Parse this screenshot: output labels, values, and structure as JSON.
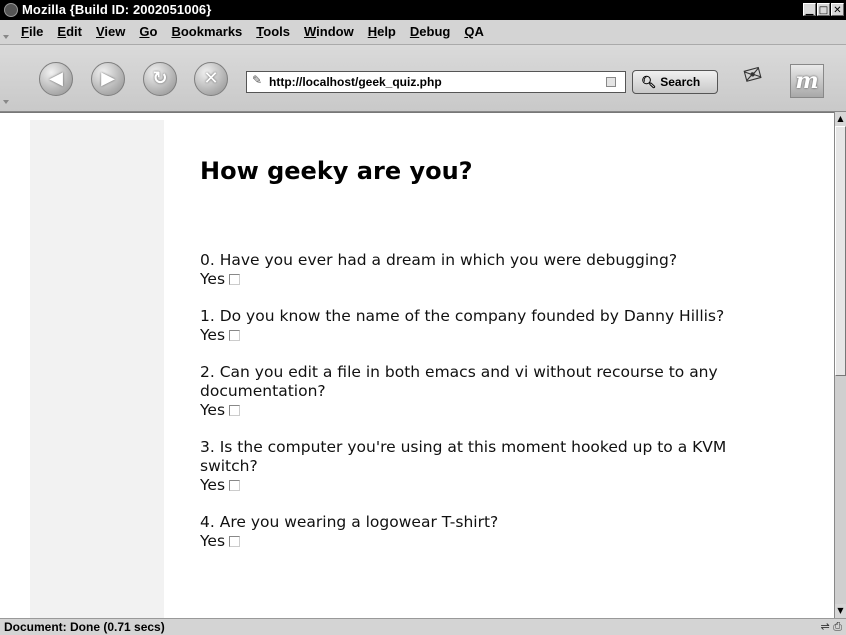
{
  "window": {
    "title": "Mozilla {Build ID: 2002051006}"
  },
  "menu": [
    "File",
    "Edit",
    "View",
    "Go",
    "Bookmarks",
    "Tools",
    "Window",
    "Help",
    "Debug",
    "QA"
  ],
  "toolbar": {
    "back_glyph": "◀",
    "forward_glyph": "▶",
    "reload_glyph": "↻",
    "stop_glyph": "✕",
    "url": "http://localhost/geek_quiz.php",
    "search_label": "Search",
    "brand_glyph": "m"
  },
  "page": {
    "title": "How geeky are you?",
    "yes_label": "Yes",
    "questions": [
      "0. Have you ever had a dream in which you were debugging?",
      "1. Do you know the name of the company founded by Danny Hillis?",
      "2. Can you edit a file in both emacs and vi without recourse to any documentation?",
      "3. Is the computer you're using at this moment hooked up to a KVM switch?",
      "4. Are you wearing a logowear T-shirt?"
    ]
  },
  "status": {
    "text": "Document: Done (0.71 secs)"
  }
}
